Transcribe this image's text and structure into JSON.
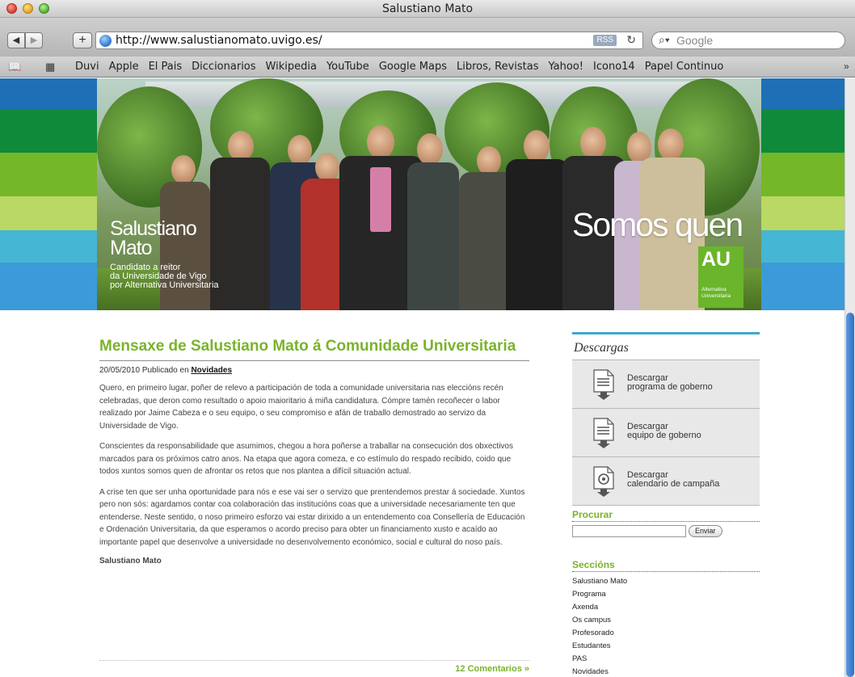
{
  "window": {
    "title": "Salustiano Mato"
  },
  "toolbar": {
    "back_label": "◀",
    "forward_label": "▶",
    "add_label": "+",
    "url": "http://www.salustianomato.uvigo.es/",
    "rss_label": "RSS",
    "search_placeholder": "Google"
  },
  "bookmarks": [
    "Duvi",
    "Apple",
    "El Pais",
    "Diccionarios",
    "Wikipedia",
    "YouTube",
    "Google Maps",
    "Libros, Revistas",
    "Yahoo!",
    "Icono14",
    "Papel Continuo"
  ],
  "banner": {
    "name_line1": "Salustiano",
    "name_line2": "Mato",
    "subtitle_line1": "Candidato a reitor",
    "subtitle_line2": "da Universidade de Vigo",
    "subtitle_line3": "por Alternativa Universitaria",
    "slogan": "Somos quen",
    "logo_text": "AU",
    "logo_sub_line1": "Alternativa",
    "logo_sub_line2": "Universitaria"
  },
  "post": {
    "title": "Mensaxe de Salustiano Mato á Comunidade Universitaria",
    "date": "20/05/2010 Publicado en",
    "category": "Novidades",
    "paragraphs": [
      "Quero, en primeiro lugar, poñer de relevo a participación de toda a comunidade universitaria nas eleccións recén celebradas, que deron como resultado o apoio maioritario á miña candidatura. Cómpre tamén recoñecer o labor realizado por Jaime Cabeza e o seu equipo, o seu compromiso e afán de traballo demostrado ao servizo da Universidade de  Vigo.",
      "Conscientes da responsabilidade que asumimos, chegou a hora  poñerse a traballar na consecución dos obxectivos marcados para os próximos catro anos. Na etapa que agora comeza, e co estímulo do respado recibido, coido que todos xuntos somos quen de afrontar os retos que nos plantea a difícil situación actual.",
      "A crise ten que ser unha oportunidade para nós e ese vai ser o servizo que prentendemos prestar á sociedade. Xuntos pero non sós: agardamos contar coa colaboración das institucións coas que a universidade necesariamente ten que entenderse. Neste sentido, o noso primeiro esforzo vai estar dirixido a un entendemento coa Consellería de Educación e Ordenación Universitaria, da que esperamos o acordo preciso para obter un financiamento xusto e acaído ao importante papel que desenvolve a universidade no desenvolvemento económico, social e cultural do noso país."
    ],
    "signature": "Salustiano Mato",
    "comments_link": "12 Comentarios »"
  },
  "sidebar": {
    "downloads_title": "Descargas",
    "downloads": [
      {
        "line1": "Descargar",
        "line2": "programa de goberno"
      },
      {
        "line1": "Descargar",
        "line2": "equipo de goberno"
      },
      {
        "line1": "Descargar",
        "line2": "calendario de campaña"
      }
    ],
    "search_title": "Procurar",
    "search_button": "Enviar",
    "sections_title": "Seccións",
    "sections": [
      "Salustiano Mato",
      "Programa",
      "Axenda",
      "Os campus",
      "Profesorado",
      "Estudantes",
      "PAS",
      "Novidades"
    ]
  },
  "colors": {
    "accent_green": "#7ab32c",
    "accent_blue": "#3ca9cf",
    "stripe_blue_dark": "#1f6fb7",
    "stripe_green_dark": "#0f8a3a",
    "stripe_lime": "#74b728",
    "stripe_cyan": "#45b6d3",
    "stripe_blue_light": "#3d9ad8"
  }
}
